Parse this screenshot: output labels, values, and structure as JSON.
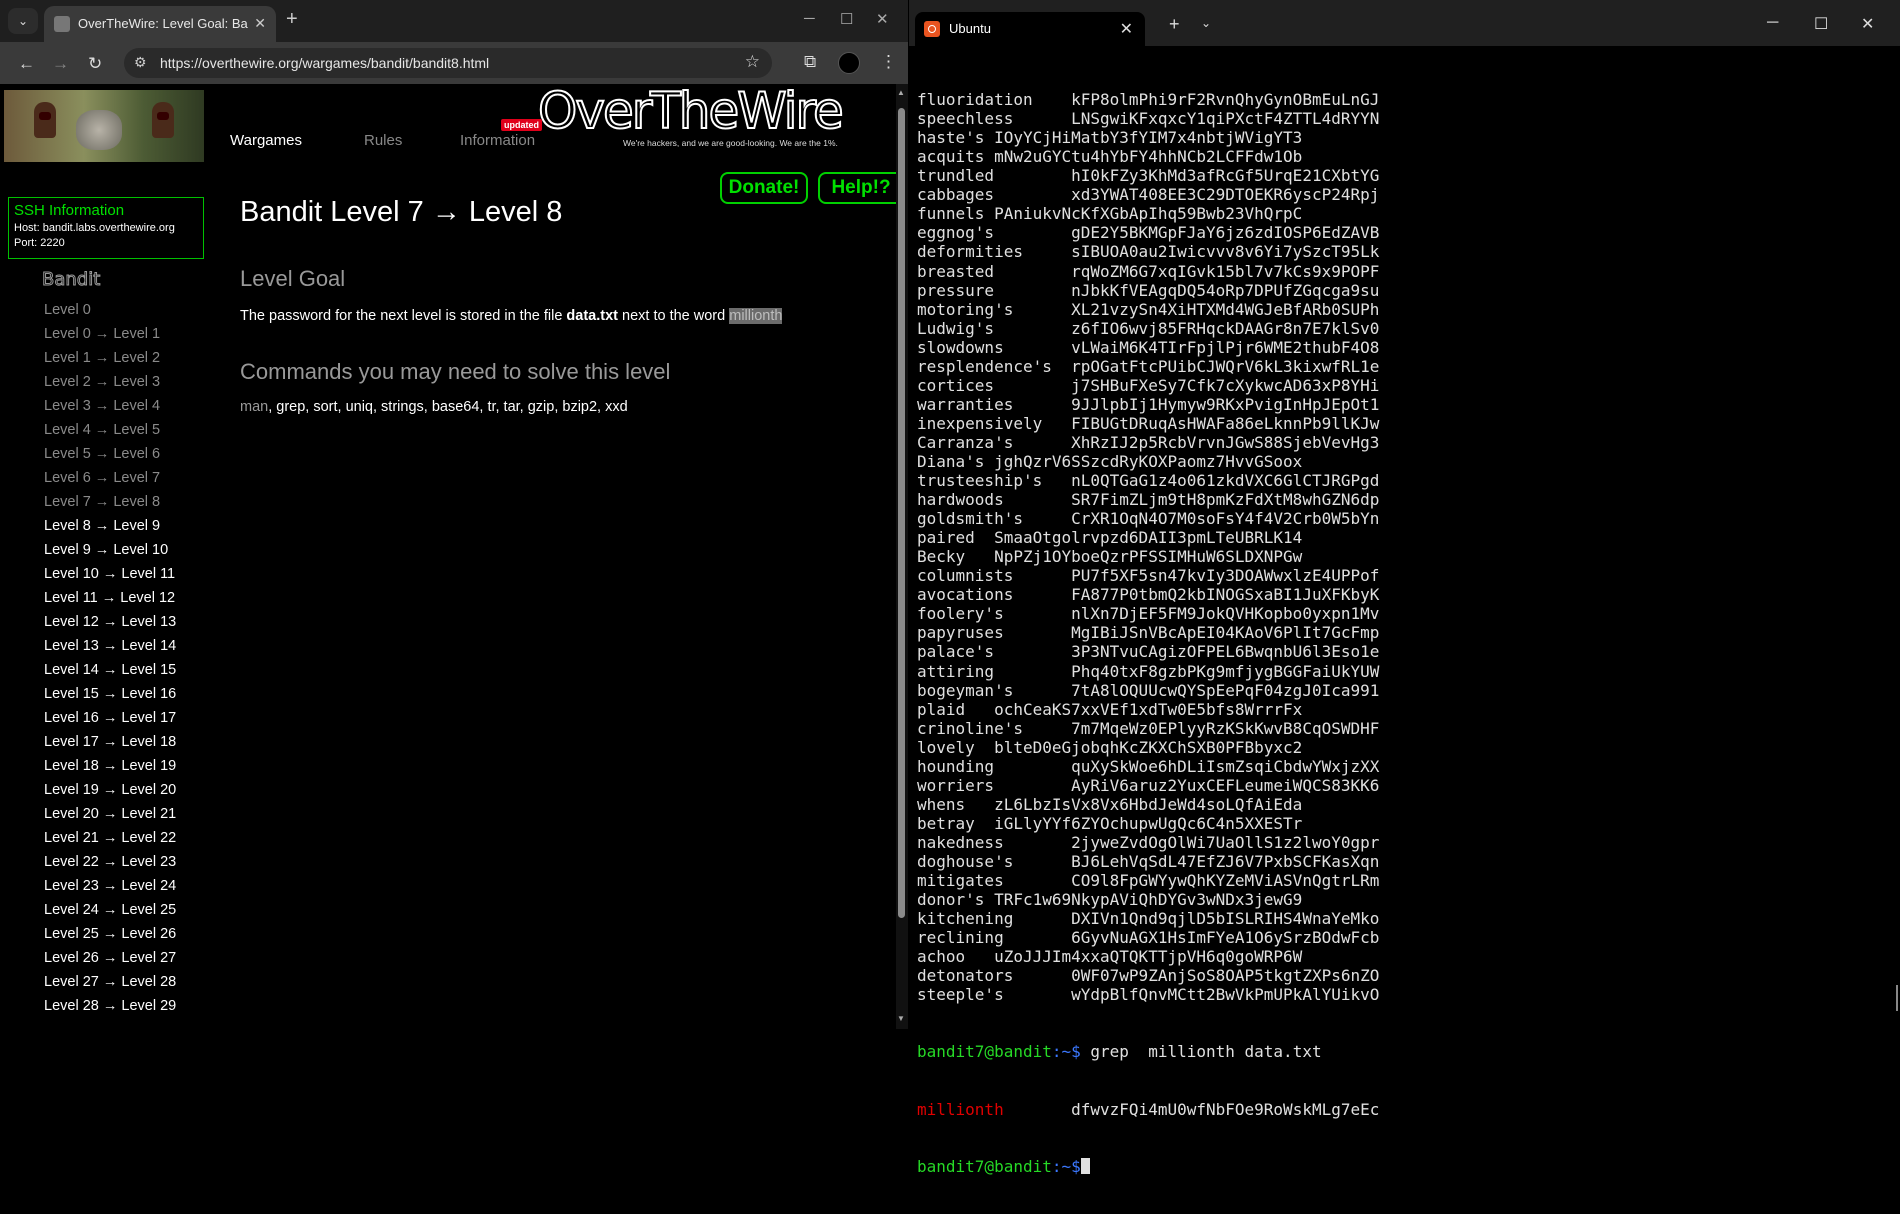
{
  "browser": {
    "tab": {
      "title": "OverTheWire: Level Goal: Bandit Level 7 → Level 8"
    },
    "url": "https://overthewire.org/wargames/bandit/bandit8.html",
    "nav": {
      "wargames": "Wargames",
      "rules": "Rules",
      "information": "Information",
      "updated_badge": "updated"
    },
    "logo": {
      "text": "OverTheWire",
      "tagline": "We're hackers, and we are good-looking. We are the 1%."
    },
    "buttons": {
      "donate": "Donate!",
      "help": "Help!?"
    },
    "ssh": {
      "title": "SSH Information",
      "host": "Host: bandit.labs.overthewire.org",
      "port": "Port: 2220"
    },
    "bandit_logo": "Bandit",
    "level_list": [
      "Level 0",
      "Level 0 → Level 1",
      "Level 1 → Level 2",
      "Level 2 → Level 3",
      "Level 3 → Level 4",
      "Level 4 → Level 5",
      "Level 5 → Level 6",
      "Level 6 → Level 7",
      "Level 7 → Level 8",
      "Level 8 → Level 9",
      "Level 9 → Level 10",
      "Level 10 → Level 11",
      "Level 11 → Level 12",
      "Level 12 → Level 13",
      "Level 13 → Level 14",
      "Level 14 → Level 15",
      "Level 15 → Level 16",
      "Level 16 → Level 17",
      "Level 17 → Level 18",
      "Level 18 → Level 19",
      "Level 19 → Level 20",
      "Level 20 → Level 21",
      "Level 21 → Level 22",
      "Level 22 → Level 23",
      "Level 23 → Level 24",
      "Level 24 → Level 25",
      "Level 25 → Level 26",
      "Level 26 → Level 27",
      "Level 27 → Level 28",
      "Level 28 → Level 29"
    ],
    "content": {
      "title": "Bandit Level 7 → Level 8",
      "goal_heading": "Level Goal",
      "goal_text_before": "The password for the next level is stored in the file ",
      "goal_file": "data.txt",
      "goal_text_mid": " next to the word ",
      "goal_word": "millionth",
      "commands_heading": "Commands you may need to solve this level",
      "commands_first": "man",
      "commands_rest": ", grep, sort, uniq, strings, base64, tr, tar, gzip, bzip2, xxd"
    }
  },
  "terminal": {
    "tab_title": "Ubuntu",
    "lines": [
      "fluoridation    kFP8olmPhi9rF2RvnQhyGynOBmEuLnGJ",
      "speechless      LNSgwiKFxqxcY1qiPXctF4ZTTL4dRYYN",
      "haste's IOyYCjHiMatbY3fYIM7x4nbtjWVigYT3",
      "acquits mNw2uGYCtu4hYbFY4hhNCb2LCFFdw1Ob",
      "trundled        hI0kFZy3KhMd3afRcGf5UrqE21CXbtYG",
      "cabbages        xd3YWAT408EE3C29DTOEKR6yscP24Rpj",
      "funnels PAniukvNcKfXGbApIhq59Bwb23VhQrpC",
      "eggnog's        gDE2Y5BKMGpFJaY6jz6zdIOSP6EdZAVB",
      "deformities     sIBUOA0au2Iwicvvv8v6Yi7ySzcT95Lk",
      "breasted        rqWoZM6G7xqIGvk15bl7v7kCs9x9POPF",
      "pressure        nJbkKfVEAgqDQ54oRp7DPUfZGqcga9su",
      "motoring's      XL21vzySn4XiHTXMd4WGJeBfARb0SUPh",
      "Ludwig's        z6fIO6wvj85FRHqckDAAGr8n7E7klSv0",
      "slowdowns       vLWaiM6K4TIrFpjlPjr6WME2thubF4O8",
      "resplendence's  rpOGatFtcPUibCJWQrV6kL3kixwfRL1e",
      "cortices        j7SHBuFXeSy7Cfk7cXykwcAD63xP8YHi",
      "warranties      9JJlpbIj1Hymyw9RKxPvigInHpJEpOt1",
      "inexpensively   FIBUGtDRuqAsHWAFa86eLknnPb9llKJw",
      "Carranza's      XhRzIJ2p5RcbVrvnJGwS88SjebVevHg3",
      "Diana's jghQzrV6SSzcdRyKOXPaomz7HvvGSoox",
      "trusteeship's   nL0QTGaG1z4o061zkdVXC6GlCTJRGPgd",
      "hardwoods       SR7FimZLjm9tH8pmKzFdXtM8whGZN6dp",
      "goldsmith's     CrXR1OqN4O7M0soFsY4f4V2Crb0W5bYn",
      "paired  SmaaOtgolrvpzd6DAII3pmLTeUBRLK14",
      "Becky   NpPZj1OYboeQzrPFSSIMHuW6SLDXNPGw",
      "columnists      PU7f5XF5sn47kvIy3DOAWwxlzE4UPPof",
      "avocations      FA877P0tbmQ2kbINOGSxaBI1JuXFKbyK",
      "foolery's       nlXn7DjEF5FM9JokQVHKopbo0yxpn1Mv",
      "papyruses       MgIBiJSnVBcApEI04KAoV6PlIt7GcFmp",
      "palace's        3P3NTvuCAgizOFPEL6BwqnbU6l3Eso1e",
      "attiring        Phq40txF8gzbPKg9mfjygBGGFaiUkYUW",
      "bogeyman's      7tA8lOQUUcwQYSpEePqF04zgJ0Ica991",
      "plaid   ochCeaKS7xxVEf1xdTw0E5bfs8WrrrFx",
      "crinoline's     7m7MqeWz0EPlyyRzKSkKwvB8CqOSWDHF",
      "lovely  blteD0eGjobqhKcZKXChSXB0PFBbyxc2",
      "hounding        quXySkWoe6hDLiIsmZsqiCbdwYWxjzXX",
      "worriers        AyRiV6aruz2YuxCEFLeumeiWQCS83KK6",
      "whens   zL6LbzIsVx8Vx6HbdJeWd4soLQfAiEda",
      "betray  iGLlyYYf6ZYOchupwUgQc6C4n5XXESTr",
      "nakedness       2jyweZvdOgOlWi7UaOllS1z2lwoY0gpr",
      "doghouse's      BJ6LehVqSdL47EfZJ6V7PxbSCFKasXqn",
      "mitigates       CO9l8FpGWYywQhKYZeMViASVnQgtrLRm",
      "donor's TRFc1w69NkypAViQhDYGv3wNDx3jewG9",
      "kitchening      DXIVn1Qnd9qjlD5bISLRIHS4WnaYeMko",
      "reclining       6GyvNuAGX1HsImFYeA1O6ySrzBOdwFcb",
      "achoo   uZoJJJIm4xxaQTQKTTjpVH6q0goWRP6W",
      "detonators      0WF07wP9ZAnjSoS8OAP5tkgtZXPs6nZO",
      "steeple's       wYdpBlfQnvMCtt2BwVkPmUPkAlYUikvO"
    ],
    "prompt_user": "bandit7@bandit",
    "prompt_path": ":~$",
    "command": " grep  millionth data.txt",
    "result_match": "millionth",
    "result_value": "       dfwvzFQi4mU0wfNbFOe9RoWskMLg7eEc"
  }
}
